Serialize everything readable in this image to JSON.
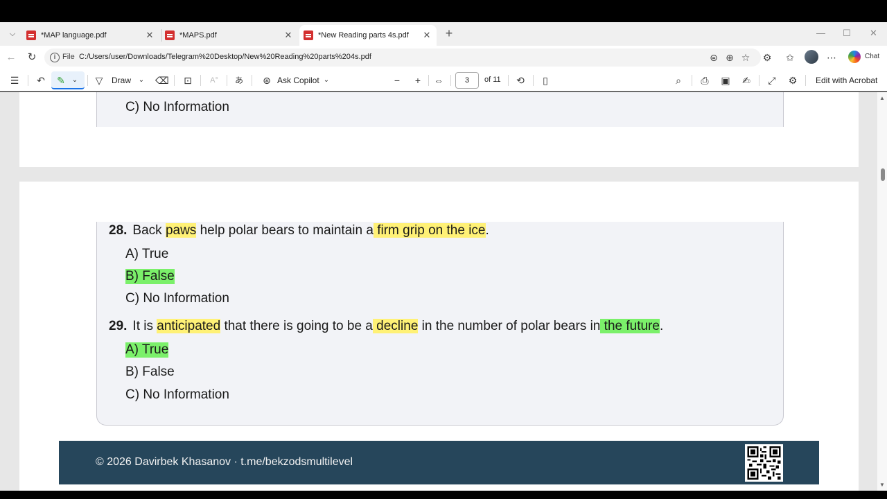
{
  "tabs": [
    {
      "title": "*MAP language.pdf",
      "close": "✕"
    },
    {
      "title": "*MAPS.pdf",
      "close": "✕"
    },
    {
      "title": "*New Reading parts 4s.pdf",
      "close": "✕"
    }
  ],
  "new_tab": "+",
  "window_controls": {
    "minimize": "—",
    "maximize": "☐",
    "close": "✕"
  },
  "address": {
    "scheme_label": "File",
    "url": "C:/Users/user/Downloads/Telegram%20Desktop/New%20Reading%20parts%204s.pdf",
    "chat_label": "Chat"
  },
  "pdf_toolbar": {
    "draw_label": "Draw",
    "copilot_label": "Ask Copilot",
    "current_page": "3",
    "page_total": "of 11",
    "edit_label": "Edit with Acrobat"
  },
  "page2": {
    "option_c": "C) No Information"
  },
  "page3": {
    "q28": {
      "number": "28.",
      "parts": [
        "Back ",
        "paws",
        " help polar bears to maintain a",
        " firm grip on the ice",
        "."
      ],
      "options": [
        "A) True",
        "B) False",
        "C) No Information"
      ],
      "answer": "B) False"
    },
    "q29": {
      "number": "29.",
      "parts": [
        "It is ",
        "anticipated",
        " that there is going to be a",
        " decline",
        " in the number of polar bears in",
        " the future",
        "."
      ],
      "options": [
        "A) True",
        "B) False",
        "C) No Information"
      ],
      "answer": "A) True"
    },
    "footer": "© 2026 Davirbek Khasanov · t.me/bekzodsmultilevel"
  },
  "colors": {
    "highlight_yellow": "#fff176",
    "highlight_green": "#7bf06a",
    "footer_bg": "#26465b"
  }
}
